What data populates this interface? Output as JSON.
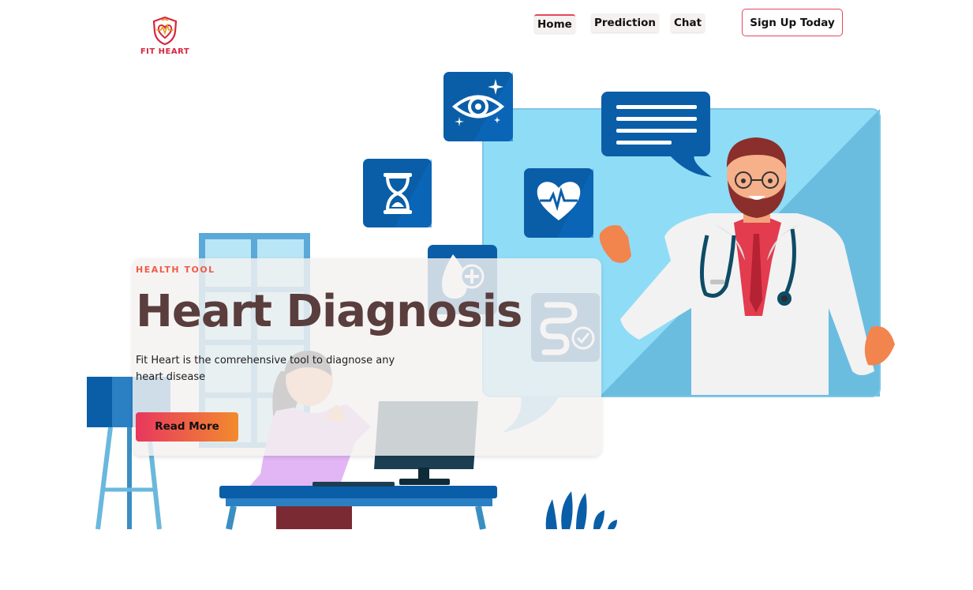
{
  "brand": {
    "name": "FIT HEART",
    "logo_icon": "heart-shield-icon"
  },
  "nav": {
    "items": [
      {
        "label": "Home",
        "active": true
      },
      {
        "label": "Prediction",
        "active": false
      },
      {
        "label": "Chat",
        "active": false
      }
    ],
    "signup_label": "Sign Up Today"
  },
  "hero": {
    "kicker": "HEALTH TOOL",
    "title": "Heart Diagnosis",
    "description": "Fit Heart is the comrehensive tool to diagnose any heart disease",
    "cta_label": "Read More"
  },
  "illustration": {
    "icons": [
      "eye-icon",
      "hourglass-icon",
      "heartbeat-icon",
      "blood-drop-plus-icon",
      "intestine-check-icon",
      "chat-bubble-icon"
    ]
  },
  "colors": {
    "accent": "#e8465b",
    "title": "#5a3d3d",
    "kicker": "#f05a48",
    "icon_blue": "#0a5ea8",
    "screen_blue": "#7cc6e6"
  }
}
